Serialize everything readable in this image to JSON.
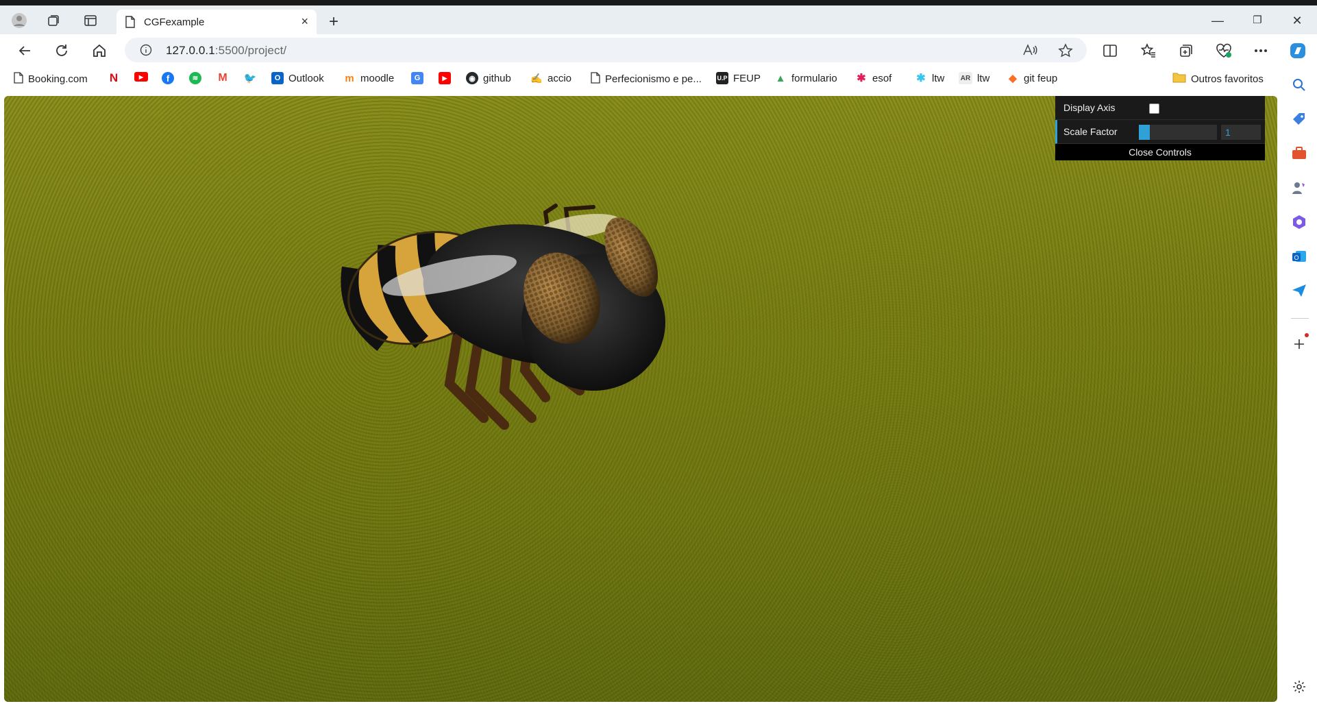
{
  "browser": {
    "tab_title": "CGFexample",
    "new_tab_symbol": "+",
    "tab_close_symbol": "×",
    "url_host": "127.0.0.1",
    "url_rest": ":5500/project/",
    "window": {
      "minimize": "—",
      "maximize": "❐",
      "close": "✕"
    }
  },
  "bookmarks": [
    {
      "label": "Booking.com",
      "icon": "page-icon"
    },
    {
      "label": "",
      "icon": "netflix-icon"
    },
    {
      "label": "",
      "icon": "youtube-icon"
    },
    {
      "label": "",
      "icon": "facebook-icon"
    },
    {
      "label": "",
      "icon": "spotify-icon"
    },
    {
      "label": "",
      "icon": "gmail-icon"
    },
    {
      "label": "",
      "icon": "twitter-icon"
    },
    {
      "label": "Outlook",
      "icon": "outlook-icon"
    },
    {
      "label": "moodle",
      "icon": "moodle-icon"
    },
    {
      "label": "",
      "icon": "translate-icon"
    },
    {
      "label": "",
      "icon": "video-icon"
    },
    {
      "label": "github",
      "icon": "github-icon"
    },
    {
      "label": "accio",
      "icon": "accio-icon"
    },
    {
      "label": "Perfecionismo e pe...",
      "icon": "page-icon"
    },
    {
      "label": "FEUP",
      "icon": "feup-icon"
    },
    {
      "label": "formulario",
      "icon": "drive-icon"
    },
    {
      "label": "esof",
      "icon": "slack-icon"
    },
    {
      "label": "ltw",
      "icon": "slack-icon"
    },
    {
      "label": "ltw",
      "icon": "ar-icon"
    },
    {
      "label": "git feup",
      "icon": "gitlab-icon"
    }
  ],
  "other_favorites": "Outros favoritos",
  "gui": {
    "display_axis_label": "Display Axis",
    "display_axis_checked": false,
    "scale_factor_label": "Scale Factor",
    "scale_factor_value": "1",
    "scale_factor_fraction": 0.14,
    "close_label": "Close Controls"
  },
  "colors": {
    "gui_accent": "#2fa1d6",
    "gui_bg": "#1a1a1a",
    "grass": "#7a7e14"
  }
}
